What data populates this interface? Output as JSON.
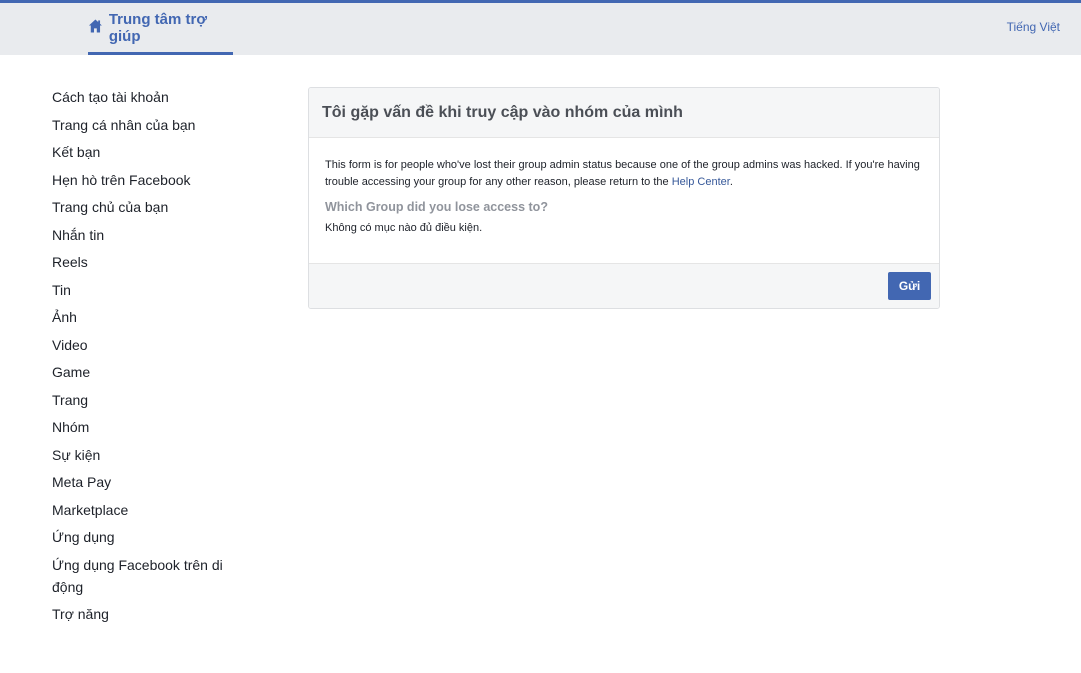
{
  "header": {
    "brand_label": "Trung tâm trợ giúp",
    "brand_icon": "house-icon",
    "language_label": "Tiếng Việt",
    "accent_color": "#4267b2"
  },
  "sidebar": {
    "items": [
      {
        "label": "Cách tạo tài khoản"
      },
      {
        "label": "Trang cá nhân của bạn"
      },
      {
        "label": "Kết bạn"
      },
      {
        "label": "Hẹn hò trên Facebook"
      },
      {
        "label": "Trang chủ của bạn"
      },
      {
        "label": "Nhắn tin"
      },
      {
        "label": "Reels"
      },
      {
        "label": "Tin"
      },
      {
        "label": "Ảnh"
      },
      {
        "label": "Video"
      },
      {
        "label": "Game"
      },
      {
        "label": "Trang"
      },
      {
        "label": "Nhóm"
      },
      {
        "label": "Sự kiện"
      },
      {
        "label": "Meta Pay"
      },
      {
        "label": "Marketplace"
      },
      {
        "label": "Ứng dụng"
      },
      {
        "label": "Ứng dụng Facebook trên di động"
      },
      {
        "label": "Trợ năng"
      }
    ]
  },
  "form": {
    "title": "Tôi gặp vấn đề khi truy cập vào nhóm của mình",
    "description_prefix": "This form is for people who've lost their group admin status because one of the group admins was hacked. If you're having trouble accessing your group for any other reason, please return to the ",
    "help_center_link": "Help Center",
    "description_suffix": ".",
    "question": "Which Group did you lose access to?",
    "no_items_text": "Không có mục nào đủ điều kiện.",
    "submit_label": "Gửi"
  }
}
